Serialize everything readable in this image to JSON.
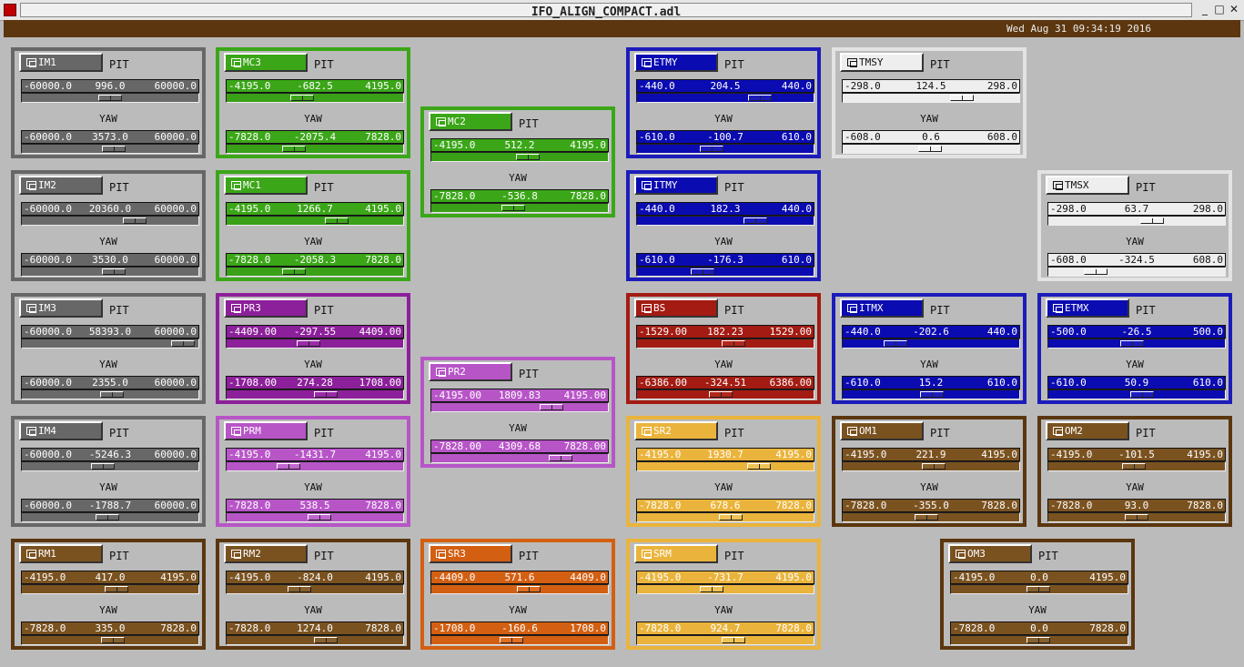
{
  "window": {
    "title": "IFO_ALIGN_COMPACT.adl",
    "min": "_",
    "max": "□",
    "close": "✕"
  },
  "header": {
    "timestamp": "Wed Aug 31 09:34:19 2016"
  },
  "labels": {
    "pit": "PIT",
    "yaw": "YAW"
  },
  "themes": {
    "gray": {
      "border": "#676767",
      "bar": "#676767",
      "track": "#6a6a6a",
      "thumb": "#6a6a6a",
      "text": "#ffffff"
    },
    "green": {
      "border": "#3ba618",
      "bar": "#3ba618",
      "track": "#39a017",
      "thumb": "#3ba618",
      "text": "#ffffff"
    },
    "blue": {
      "border": "#1c1cbb",
      "bar": "#0b0bb2",
      "track": "#0b0bb2",
      "thumb": "#1c1cc0",
      "text": "#ffffff"
    },
    "white": {
      "border": "#e3e3e3",
      "bar": "#eeeeee",
      "track": "#ededed",
      "thumb": "#f3f3f3",
      "text": "#111111"
    },
    "purple": {
      "border": "#8c1f9a",
      "bar": "#8c1f9a",
      "track": "#8c1f9a",
      "thumb": "#9a2aa8",
      "text": "#ffffff"
    },
    "violet": {
      "border": "#b755c7",
      "bar": "#b755c7",
      "track": "#b755c7",
      "thumb": "#c166d0",
      "text": "#ffffff"
    },
    "red": {
      "border": "#a31b12",
      "bar": "#a31b12",
      "track": "#a31b12",
      "thumb": "#b3271b",
      "text": "#ffffff"
    },
    "yellow": {
      "border": "#eab43c",
      "bar": "#eab43c",
      "track": "#eab43c",
      "thumb": "#f0c254",
      "text": "#ffffff"
    },
    "brown": {
      "border": "#5b360e",
      "bar": "#7a5220",
      "track": "#7a5220",
      "thumb": "#87602e",
      "text": "#ffffff"
    },
    "orange": {
      "border": "#d35f12",
      "bar": "#d35f12",
      "track": "#d35f12",
      "thumb": "#e06e20",
      "text": "#ffffff"
    }
  },
  "panels": [
    {
      "id": "IM1",
      "theme": "gray",
      "pit": {
        "min": "-60000.0",
        "val": "996.0",
        "max": "60000.0",
        "pos": 0.508
      },
      "yaw": {
        "min": "-60000.0",
        "val": "3573.0",
        "max": "60000.0",
        "pos": 0.53
      }
    },
    {
      "id": "IM2",
      "theme": "gray",
      "pit": {
        "min": "-60000.0",
        "val": "20360.0",
        "max": "60000.0",
        "pos": 0.67
      },
      "yaw": {
        "min": "-60000.0",
        "val": "3530.0",
        "max": "60000.0",
        "pos": 0.529
      }
    },
    {
      "id": "IM3",
      "theme": "gray",
      "pit": {
        "min": "-60000.0",
        "val": "58393.0",
        "max": "60000.0",
        "pos": 0.987
      },
      "yaw": {
        "min": "-60000.0",
        "val": "2355.0",
        "max": "60000.0",
        "pos": 0.52
      }
    },
    {
      "id": "IM4",
      "theme": "gray",
      "pit": {
        "min": "-60000.0",
        "val": "-5246.3",
        "max": "60000.0",
        "pos": 0.456
      },
      "yaw": {
        "min": "-60000.0",
        "val": "-1788.7",
        "max": "60000.0",
        "pos": 0.485
      }
    },
    {
      "id": "RM1",
      "theme": "brown",
      "pit": {
        "min": "-4195.0",
        "val": "417.0",
        "max": "4195.0",
        "pos": 0.55
      },
      "yaw": {
        "min": "-7828.0",
        "val": "335.0",
        "max": "7828.0",
        "pos": 0.521
      }
    },
    {
      "id": "MC3",
      "theme": "green",
      "pit": {
        "min": "-4195.0",
        "val": "-682.5",
        "max": "4195.0",
        "pos": 0.419
      },
      "yaw": {
        "min": "-7828.0",
        "val": "-2075.4",
        "max": "7828.0",
        "pos": 0.367
      }
    },
    {
      "id": "MC1",
      "theme": "green",
      "pit": {
        "min": "-4195.0",
        "val": "1266.7",
        "max": "4195.0",
        "pos": 0.651
      },
      "yaw": {
        "min": "-7828.0",
        "val": "-2058.3",
        "max": "7828.0",
        "pos": 0.369
      }
    },
    {
      "id": "PR3",
      "theme": "purple",
      "pit": {
        "min": "-4409.00",
        "val": "-297.55",
        "max": "4409.00",
        "pos": 0.466
      },
      "yaw": {
        "min": "-1708.00",
        "val": "274.28",
        "max": "1708.00",
        "pos": 0.58
      }
    },
    {
      "id": "PRM",
      "theme": "violet",
      "pit": {
        "min": "-4195.0",
        "val": "-1431.7",
        "max": "4195.0",
        "pos": 0.329
      },
      "yaw": {
        "min": "-7828.0",
        "val": "538.5",
        "max": "7828.0",
        "pos": 0.534
      }
    },
    {
      "id": "RM2",
      "theme": "brown",
      "pit": {
        "min": "-4195.0",
        "val": "-824.0",
        "max": "4195.0",
        "pos": 0.402
      },
      "yaw": {
        "min": "-7828.0",
        "val": "1274.0",
        "max": "7828.0",
        "pos": 0.581
      }
    },
    {
      "id": "MC2",
      "theme": "green",
      "pit": {
        "min": "-4195.0",
        "val": "512.2",
        "max": "4195.0",
        "pos": 0.561
      },
      "yaw": {
        "min": "-7828.0",
        "val": "-536.8",
        "max": "7828.0",
        "pos": 0.466
      }
    },
    {
      "id": "PR2",
      "theme": "violet",
      "pit": {
        "min": "-4195.00",
        "val": "1809.83",
        "max": "4195.00",
        "pos": 0.716
      },
      "yaw": {
        "min": "-7828.00",
        "val": "4309.68",
        "max": "7828.00",
        "pos": 0.775
      }
    },
    {
      "id": "SR3",
      "theme": "orange",
      "pit": {
        "min": "-4409.0",
        "val": "571.6",
        "max": "4409.0",
        "pos": 0.565
      },
      "yaw": {
        "min": "-1708.0",
        "val": "-160.6",
        "max": "1708.0",
        "pos": 0.453
      }
    },
    {
      "id": "ETMY",
      "theme": "blue",
      "pit": {
        "min": "-440.0",
        "val": "204.5",
        "max": "440.0",
        "pos": 0.732
      },
      "yaw": {
        "min": "-610.0",
        "val": "-100.7",
        "max": "610.0",
        "pos": 0.417
      }
    },
    {
      "id": "ITMY",
      "theme": "blue",
      "pit": {
        "min": "-440.0",
        "val": "182.3",
        "max": "440.0",
        "pos": 0.707
      },
      "yaw": {
        "min": "-610.0",
        "val": "-176.3",
        "max": "610.0",
        "pos": 0.355
      }
    },
    {
      "id": "BS",
      "theme": "red",
      "pit": {
        "min": "-1529.00",
        "val": "182.23",
        "max": "1529.00",
        "pos": 0.56
      },
      "yaw": {
        "min": "-6386.00",
        "val": "-324.51",
        "max": "6386.00",
        "pos": 0.475
      }
    },
    {
      "id": "SR2",
      "theme": "yellow",
      "pit": {
        "min": "-4195.0",
        "val": "1930.7",
        "max": "4195.0",
        "pos": 0.73
      },
      "yaw": {
        "min": "-7828.0",
        "val": "678.6",
        "max": "7828.0",
        "pos": 0.543
      }
    },
    {
      "id": "SRM",
      "theme": "yellow",
      "pit": {
        "min": "-4195.0",
        "val": "-731.7",
        "max": "4195.0",
        "pos": 0.413
      },
      "yaw": {
        "min": "-7828.0",
        "val": "924.7",
        "max": "7828.0",
        "pos": 0.559
      }
    },
    {
      "id": "TMSY",
      "theme": "white",
      "pit": {
        "min": "-298.0",
        "val": "124.5",
        "max": "298.0",
        "pos": 0.709
      },
      "yaw": {
        "min": "-608.0",
        "val": "0.6",
        "max": "608.0",
        "pos": 0.5
      }
    },
    {
      "id": "ITMX",
      "theme": "blue",
      "pit": {
        "min": "-440.0",
        "val": "-202.6",
        "max": "440.0",
        "pos": 0.27
      },
      "yaw": {
        "min": "-610.0",
        "val": "15.2",
        "max": "610.0",
        "pos": 0.512
      }
    },
    {
      "id": "OM1",
      "theme": "brown",
      "pit": {
        "min": "-4195.0",
        "val": "221.9",
        "max": "4195.0",
        "pos": 0.526
      },
      "yaw": {
        "min": "-7828.0",
        "val": "-355.0",
        "max": "7828.0",
        "pos": 0.477
      }
    },
    {
      "id": "OM3",
      "theme": "brown",
      "pit": {
        "min": "-4195.0",
        "val": "0.0",
        "max": "4195.0",
        "pos": 0.5
      },
      "yaw": {
        "min": "-7828.0",
        "val": "0.0",
        "max": "7828.0",
        "pos": 0.5
      }
    },
    {
      "id": "TMSX",
      "theme": "white",
      "pit": {
        "min": "-298.0",
        "val": "63.7",
        "max": "298.0",
        "pos": 0.607
      },
      "yaw": {
        "min": "-608.0",
        "val": "-324.5",
        "max": "608.0",
        "pos": 0.233
      }
    },
    {
      "id": "ETMX",
      "theme": "blue",
      "pit": {
        "min": "-500.0",
        "val": "-26.5",
        "max": "500.0",
        "pos": 0.474
      },
      "yaw": {
        "min": "-610.0",
        "val": "50.9",
        "max": "610.0",
        "pos": 0.542
      }
    },
    {
      "id": "OM2",
      "theme": "brown",
      "pit": {
        "min": "-4195.0",
        "val": "-101.5",
        "max": "4195.0",
        "pos": 0.488
      },
      "yaw": {
        "min": "-7828.0",
        "val": "93.0",
        "max": "7828.0",
        "pos": 0.506
      }
    }
  ]
}
